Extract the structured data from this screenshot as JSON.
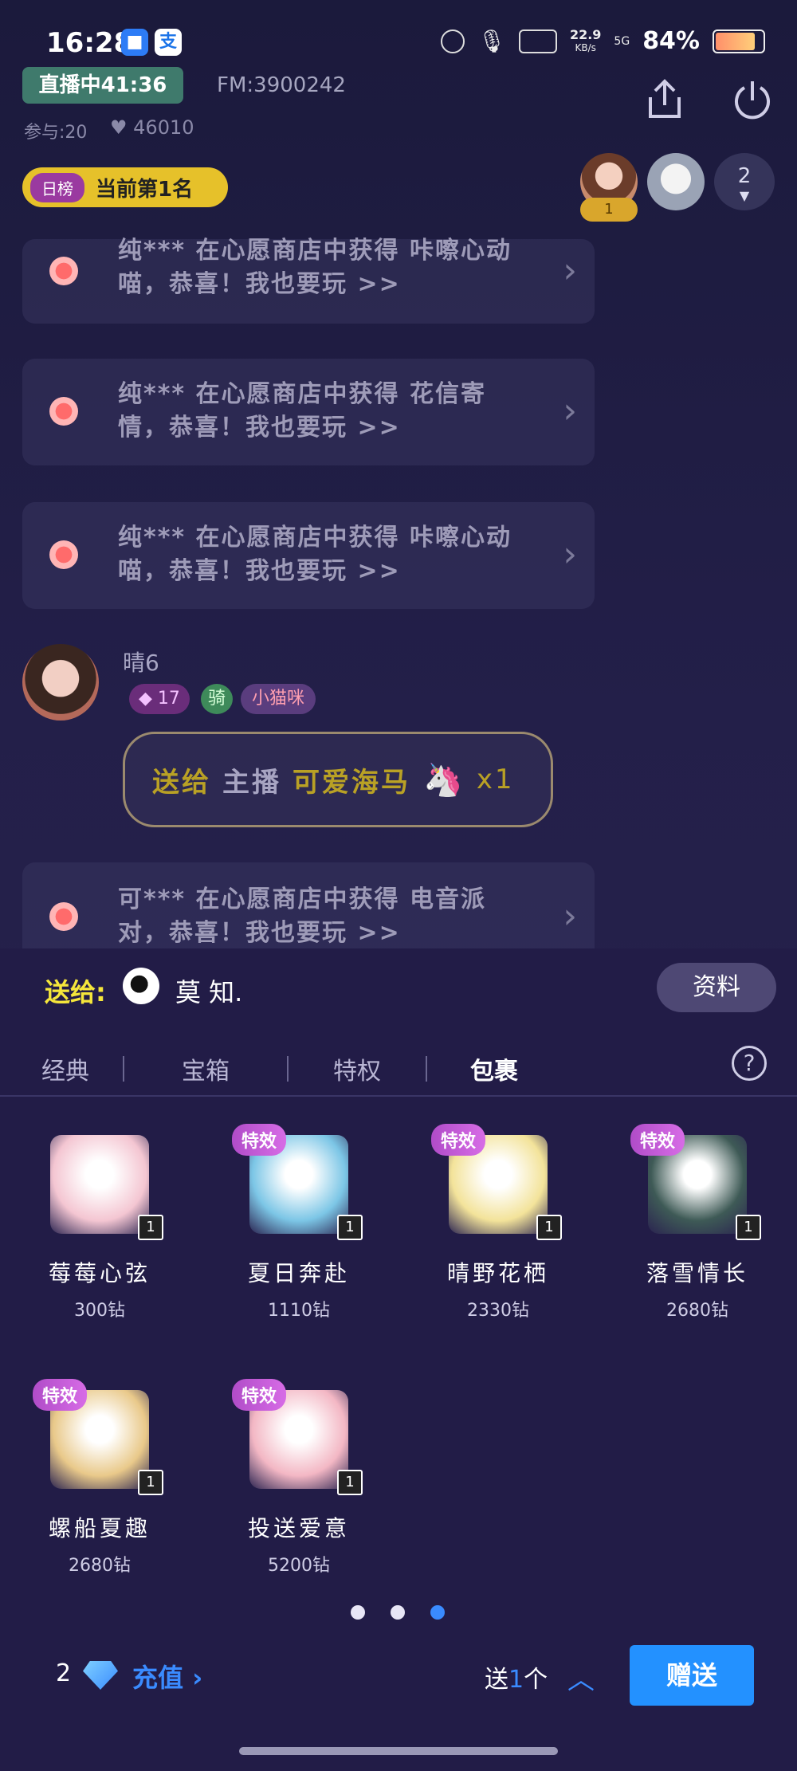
{
  "status_bar": {
    "time": "16:28",
    "app1_icon": "app-icon",
    "app2_icon": "alipay-icon",
    "net_speed": "22.9",
    "net_unit": "KB/s",
    "network": "5G",
    "battery": "84%",
    "battery_level": 0.84
  },
  "header": {
    "live_label": "直播中41:36",
    "fm": "FM:3900242",
    "participants": "参与:20",
    "likes": "46010",
    "rank_tag": "日榜",
    "rank_text": "当前第1名",
    "viewer_rank": "1",
    "viewer_count": "2"
  },
  "chat": {
    "items": [
      {
        "text": "纯*** 在心愿商店中获得 咔嚓心动喵，恭喜！我也要玩 >>"
      },
      {
        "text": "纯*** 在心愿商店中获得 花信寄情，恭喜！我也要玩 >>"
      },
      {
        "text": "纯*** 在心愿商店中获得 咔嚓心动喵，恭喜！我也要玩 >>"
      },
      {
        "text": "可*** 在心愿商店中获得 电音派对，恭喜！我也要玩 >>"
      }
    ],
    "user": {
      "name": "晴6",
      "level": "17",
      "ride": "骑",
      "tag": "小猫咪"
    },
    "gift_msg": {
      "send": "送给",
      "anchor": "主播",
      "gift": "可爱海马",
      "count": "x1"
    }
  },
  "panel": {
    "send_to_label": "送给:",
    "recipient": "莫 知.",
    "profile_btn": "资料",
    "tabs": [
      "经典",
      "宝箱",
      "特权",
      "包裹"
    ],
    "active_tab": "包裹",
    "fx_label": "特效",
    "gifts": [
      {
        "name": "莓莓心弦",
        "price": "300钻",
        "qty": "1",
        "fx": false,
        "color": "#f4c6d2"
      },
      {
        "name": "夏日奔赴",
        "price": "1110钻",
        "qty": "1",
        "fx": true,
        "color": "#7cc6e6"
      },
      {
        "name": "晴野花栖",
        "price": "2330钻",
        "qty": "1",
        "fx": true,
        "color": "#f3e39a"
      },
      {
        "name": "落雪情长",
        "price": "2680钻",
        "qty": "1",
        "fx": true,
        "color": "#3e5a56"
      },
      {
        "name": "螺船夏趣",
        "price": "2680钻",
        "qty": "1",
        "fx": true,
        "color": "#e9c98a"
      },
      {
        "name": "投送爱意",
        "price": "5200钻",
        "qty": "1",
        "fx": true,
        "color": "#f3b7c4"
      }
    ],
    "page_dots": 3,
    "active_page": 3
  },
  "footer": {
    "balance": "2",
    "recharge": "充值",
    "send_prefix": "送",
    "send_num": "1",
    "send_suffix": "个",
    "send_btn": "赠送"
  }
}
